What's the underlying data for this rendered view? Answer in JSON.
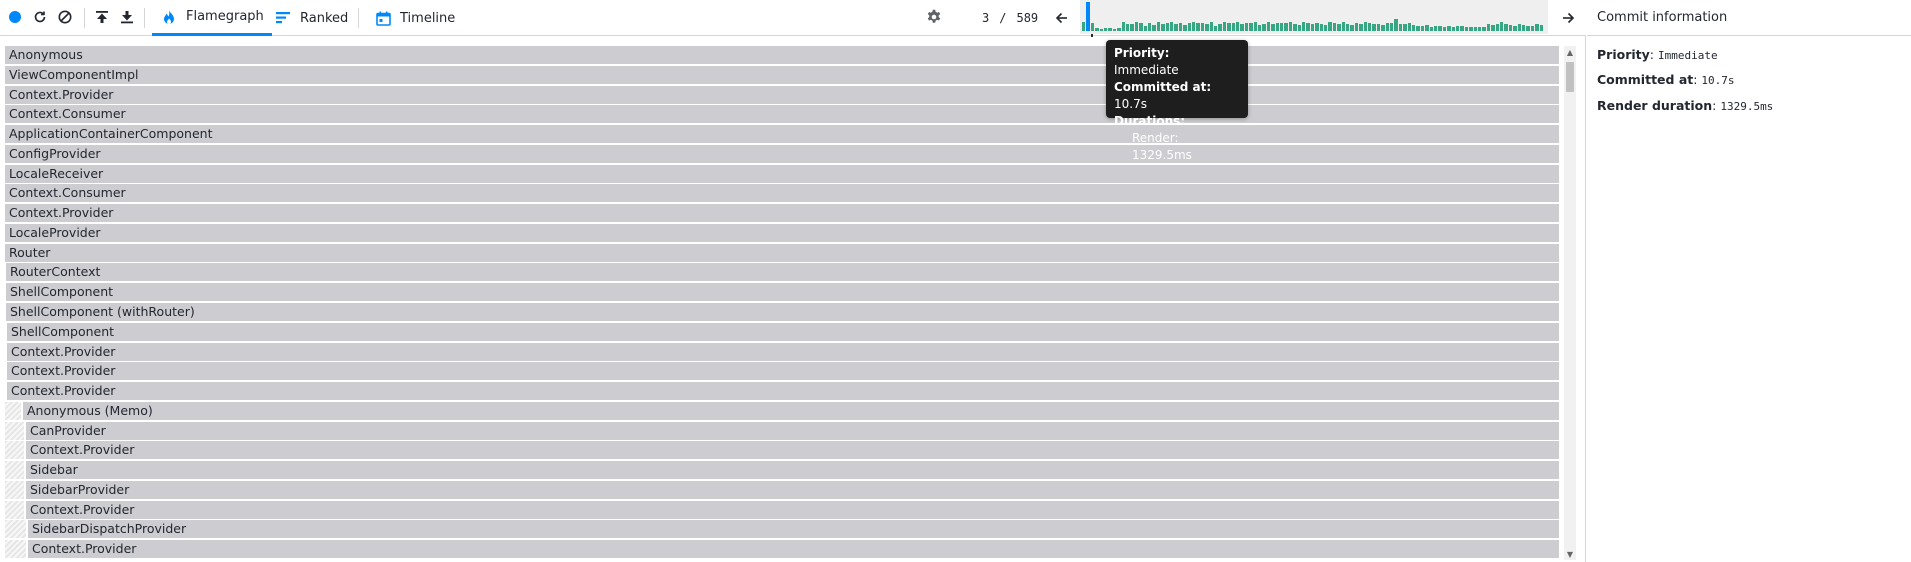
{
  "toolbar": {
    "record_icon": "record-icon",
    "reload_icon": "reload-icon",
    "clear_icon": "clear-icon",
    "upload_icon": "upload-icon",
    "download_icon": "download-icon",
    "tabs": [
      {
        "label": "Flamegraph",
        "icon": "flame-icon",
        "active": true
      },
      {
        "label": "Ranked",
        "icon": "ranked-icon",
        "active": false
      },
      {
        "label": "Timeline",
        "icon": "calendar-icon",
        "active": false
      }
    ],
    "settings_icon": "gear-icon"
  },
  "commit_nav": {
    "current": "3",
    "separator": "/",
    "total": "589",
    "prev_icon": "arrow-left-icon",
    "next_icon": "arrow-right-icon",
    "bar_heights": [
      0.3,
      0.95,
      0.25,
      0.1,
      0.08,
      0.1,
      0.09,
      0.08,
      0.1,
      0.3,
      0.22,
      0.24,
      0.3,
      0.25,
      0.15,
      0.28,
      0.2,
      0.3,
      0.22,
      0.25,
      0.3,
      0.24,
      0.26,
      0.2,
      0.28,
      0.3,
      0.25,
      0.26,
      0.22,
      0.3,
      0.18,
      0.24,
      0.3,
      0.26,
      0.28,
      0.3,
      0.22,
      0.25,
      0.28,
      0.3,
      0.2,
      0.24,
      0.3,
      0.22,
      0.26,
      0.28,
      0.25,
      0.3,
      0.22,
      0.2,
      0.3,
      0.26,
      0.22,
      0.28,
      0.24,
      0.2,
      0.3,
      0.25,
      0.22,
      0.3,
      0.24,
      0.2,
      0.28,
      0.22,
      0.3,
      0.26,
      0.24,
      0.22,
      0.2,
      0.25,
      0.28,
      0.4,
      0.22,
      0.24,
      0.26,
      0.2,
      0.15,
      0.18,
      0.2,
      0.12,
      0.15,
      0.18,
      0.14,
      0.16,
      0.12,
      0.18,
      0.15,
      0.14,
      0.12,
      0.13,
      0.14,
      0.12,
      0.22,
      0.2,
      0.24,
      0.3,
      0.22,
      0.2,
      0.18,
      0.22,
      0.2,
      0.15,
      0.16,
      0.24,
      0.2,
      0.26
    ],
    "selected_index": 1
  },
  "tooltip": {
    "priority_label": "Priority:",
    "priority_value": "Immediate",
    "committed_label": "Committed at:",
    "committed_value": "10.7s",
    "durations_label": "Durations:",
    "render_label": "Render:",
    "render_value": "1329.5ms"
  },
  "flame_rows": [
    {
      "label": "Anonymous",
      "indent": 0
    },
    {
      "label": "ViewComponentImpl",
      "indent": 0
    },
    {
      "label": "Context.Provider",
      "indent": 0
    },
    {
      "label": "Context.Consumer",
      "indent": 0
    },
    {
      "label": "ApplicationContainerComponent",
      "indent": 0
    },
    {
      "label": "ConfigProvider",
      "indent": 0
    },
    {
      "label": "LocaleReceiver",
      "indent": 0
    },
    {
      "label": "Context.Consumer",
      "indent": 0
    },
    {
      "label": "Context.Provider",
      "indent": 0
    },
    {
      "label": "LocaleProvider",
      "indent": 0
    },
    {
      "label": "Router",
      "indent": 0
    },
    {
      "label": "RouterContext",
      "indent": 1
    },
    {
      "label": "ShellComponent",
      "indent": 1
    },
    {
      "label": "ShellComponent (withRouter)",
      "indent": 1
    },
    {
      "label": "ShellComponent",
      "indent": 2
    },
    {
      "label": "Context.Provider",
      "indent": 2
    },
    {
      "label": "Context.Provider",
      "indent": 2
    },
    {
      "label": "Context.Provider",
      "indent": 2
    },
    {
      "label": "Anonymous (Memo)",
      "indent": 18
    },
    {
      "label": "CanProvider",
      "indent": 21
    },
    {
      "label": "Context.Provider",
      "indent": 21
    },
    {
      "label": "Sidebar",
      "indent": 21
    },
    {
      "label": "SidebarProvider",
      "indent": 21
    },
    {
      "label": "Context.Provider",
      "indent": 21
    },
    {
      "label": "SidebarDispatchProvider",
      "indent": 23
    },
    {
      "label": "Context.Provider",
      "indent": 23
    }
  ],
  "right_panel": {
    "title": "Commit information",
    "priority_label": "Priority",
    "priority_value": "Immediate",
    "committed_label": "Committed at",
    "committed_value": "10.7s",
    "render_label": "Render duration",
    "render_value": "1329.5ms"
  },
  "colors": {
    "accent": "#0088fa",
    "commit_bar": "#37a783",
    "flame_row": "#cdcdd1",
    "tooltip_bg": "#1e1e1e"
  }
}
